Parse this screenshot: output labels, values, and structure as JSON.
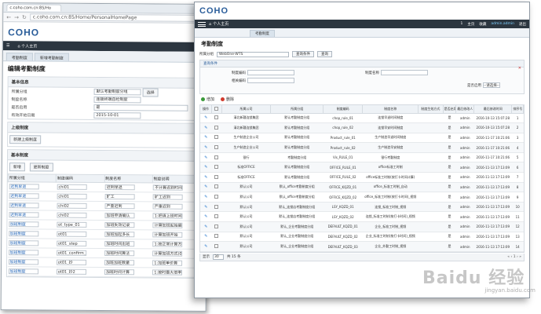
{
  "back": {
    "tab_title": "c.coho.com.cn:85/Ho",
    "url": "c.coho.com.cn:85/Home/PersonalHomePage",
    "logo": "COHO",
    "nav_home": "个人主页",
    "tabs": [
      "考勤制度",
      "新增考勤制度"
    ],
    "page_title": "编辑考勤制度",
    "basic_section": "基本信息",
    "fields": [
      {
        "label": "所属分组",
        "value": "默认考勤制度分组",
        "extra": "选择"
      },
      {
        "label": "制度名称",
        "value": "连锁终端自检制度"
      },
      {
        "label": "是否启用",
        "value": "是"
      },
      {
        "label": "有效开始日期",
        "value": "2015-10-01"
      }
    ],
    "parent_section": "上级制度",
    "parent_button": "新建上级制度",
    "basic_rules_section": "基本制度",
    "rule_buttons": [
      "新增",
      "更新制度"
    ],
    "rule_headers": [
      "所属分组",
      "制度编码",
      "制度名称",
      "制度说明"
    ],
    "rule_rows": [
      [
        "迟到早退",
        "chi01",
        "迟到早退",
        "不计算迟到时间"
      ],
      [
        "迟到早退",
        "chi01",
        "旷工",
        "旷工迟到"
      ],
      [
        "迟到早退",
        "chi02",
        "严重迟到",
        "严重迟到"
      ],
      [
        "迟到早退",
        "chi02",
        "加班申请确认",
        "1:把请上班时间并加请"
      ],
      [
        "加班制度",
        "ot_type_01",
        "加班失效记录",
        "计算加班起始最早从160条开始"
      ],
      [
        "加班制度",
        "ot01",
        "加班加起多长",
        "计算加班开始"
      ],
      [
        "加班制度",
        "ot01_step",
        "加班时间出班",
        "1:按正常计算方式"
      ],
      [
        "加班制度",
        "ot01_confirm_mode",
        "加班时间算法",
        "计算加班方式(0:开始及1)"
      ],
      [
        "加班制度",
        "ot01_抄",
        "加班加班数量",
        "1:加班单价算"
      ],
      [
        "加班制度",
        "ot01_抄2",
        "加班时间计算",
        "1:按时最大倍率"
      ]
    ]
  },
  "front": {
    "logo": "COHO",
    "nav_home": "个人主页",
    "nav_right": [
      "1",
      "主页",
      "收藏",
      "admin.admin",
      "退出"
    ],
    "tab": "考勤制度",
    "page_title": "考勤制度",
    "filter_label": "所属分组",
    "filter_value": "WebOne-WTS",
    "filter_dropdown": "查询条件",
    "filter_button": "查询",
    "adv_header": "查询条件",
    "adv_fields": [
      {
        "label": "制度编码"
      },
      {
        "label": "相关编码"
      },
      {
        "label": "制度名称"
      },
      {
        "label": "是否启用",
        "value": "--请选择--"
      }
    ],
    "add_label": "增加",
    "delete_label": "删除",
    "headers": [
      "操作",
      "",
      "所属公司",
      "所属分组",
      "制度编码",
      "制度名称",
      "制度生效方式",
      "是否启用",
      "最后修改人",
      "最后修改时间",
      "排序号"
    ],
    "rows": [
      [
        "清北新疆连锁集团",
        "默认考勤制度分组",
        "chop_rule_01",
        "连锁早退时间制度",
        "",
        "是",
        "admin",
        "2016-10-13 15:07:28",
        "1"
      ],
      [
        "清北新疆连锁集团",
        "默认考勤制度分组",
        "chop_rule_02",
        "连锁早安时间制度",
        "",
        "是",
        "admin",
        "2016-10-13 15:07:28",
        "2"
      ],
      [
        "生产制造企业公司",
        "默认考勤制度分组",
        "Product_rule_01",
        "生产制造早退时间制度",
        "",
        "是",
        "admin",
        "2016-11-17 10:21:06",
        "3"
      ],
      [
        "生产制造企业公司",
        "默认考勤制度分组",
        "Product_rule_02",
        "生产制造早安制度",
        "",
        "是",
        "admin",
        "2016-11-17 10:21:06",
        "4"
      ],
      [
        "银行",
        "考勤制度分组",
        "Vis_RULE_01",
        "银行考勤制度",
        "",
        "是",
        "admin",
        "2016-11-17 10:21:06",
        "5"
      ],
      [
        "标准OFFICE",
        "默认考勤制度分组",
        "OFFICE_RULE_01",
        "office标准工时制",
        "",
        "是",
        "admin",
        "2016-11-13 17:13:09",
        "6"
      ],
      [
        "标准OFFICE",
        "默认考勤制度分组",
        "OFFICE_RULE_02",
        "office标准工时制(按打卡时间计算)",
        "",
        "是",
        "admin",
        "2016-11-13 17:13:09",
        "7"
      ],
      [
        "默认公司",
        "默认_office考勤制度分组",
        "OFFICE_KQZD_01",
        "office_标准工时制_自动",
        "",
        "是",
        "admin",
        "2016-11-13 17:13:09",
        "8"
      ],
      [
        "默认公司",
        "默认_office考勤制度分组",
        "OFFICE_KQZD_02",
        "office_标准工时制(按打卡时间)_视频",
        "",
        "是",
        "admin",
        "2016-11-13 17:13:09",
        "9"
      ],
      [
        "默认公司",
        "默认_连锁店考勤制度分组",
        "LSY_KQZD_01",
        "连锁_标准工时制_视频",
        "",
        "是",
        "admin",
        "2016-11-13 17:13:09",
        "10"
      ],
      [
        "默认公司",
        "默认_连锁店考勤制度分组",
        "LSY_KQZD_02",
        "连锁_标准工时制(按打卡时间)_视频",
        "",
        "是",
        "admin",
        "2016-11-13 17:13:09",
        "11"
      ],
      [
        "默认公司",
        "默认_企业考勤制度分组",
        "DEFAULT_KQZD_01",
        "企业_标准工时制_视频",
        "",
        "是",
        "admin",
        "2016-11-13 17:13:09",
        "12"
      ],
      [
        "默认公司",
        "默认_企业考勤制度分组",
        "DEFAULT_KQZD_02",
        "企业_标准工时制(按打卡时间)_视频",
        "",
        "是",
        "admin",
        "2016-11-13 17:13:09",
        "13"
      ],
      [
        "默认公司",
        "默认_企业考勤制度分组",
        "DEFAULT_KQZD_03",
        "企业_外勤工时制_视频",
        "",
        "是",
        "admin",
        "2016-11-13 17:13:09",
        "14"
      ]
    ],
    "pager_prefix": "显示",
    "pager_size": "30",
    "pager_total": "共 15 条",
    "pager_pages": "« ‹ 1 › »"
  },
  "watermark": {
    "brand": "Baidu 经验",
    "url": "jingyan.baidu.com"
  }
}
